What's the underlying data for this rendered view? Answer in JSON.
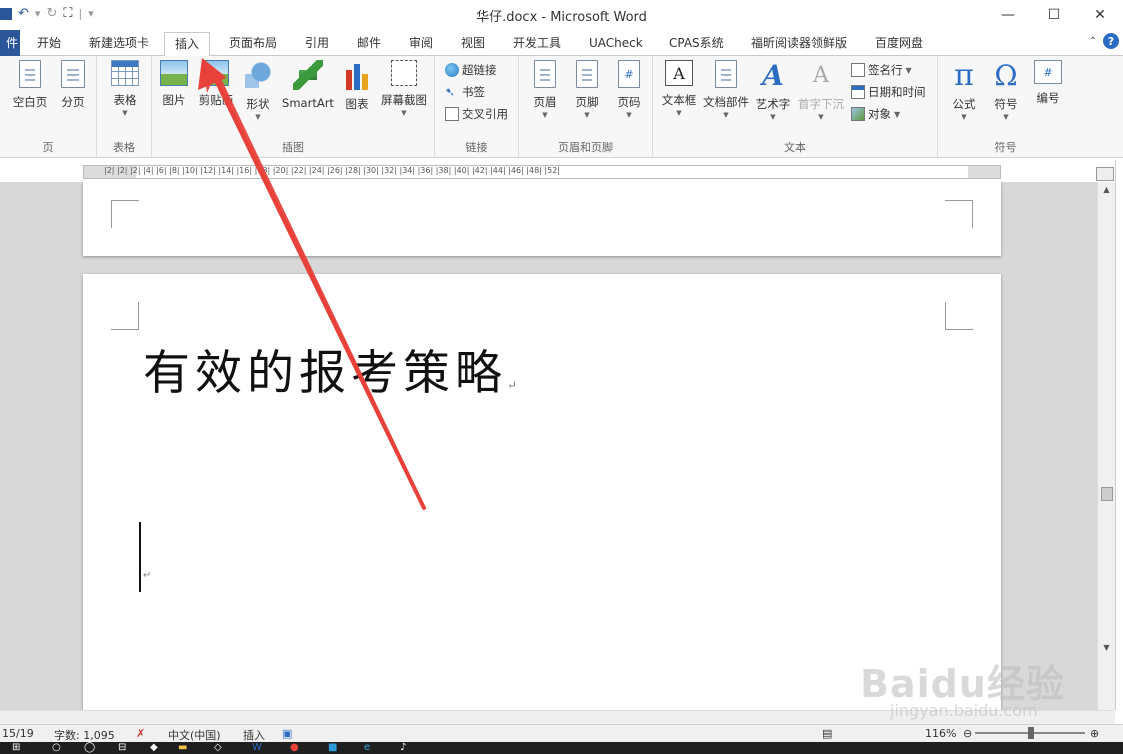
{
  "window": {
    "title": "华仔.docx - Microsoft Word",
    "qat_icons": [
      "save-icon",
      "undo-icon",
      "redo-icon",
      "tree-icon"
    ]
  },
  "tabs": {
    "file": "件",
    "items": [
      "开始",
      "新建选项卡",
      "插入",
      "页面布局",
      "引用",
      "邮件",
      "审阅",
      "视图",
      "开发工具",
      "UACheck",
      "CPAS系统",
      "福昕阅读器领鲜版",
      "百度网盘"
    ],
    "active": "插入"
  },
  "ribbon": {
    "pages": {
      "label": "页",
      "blank": "空白页",
      "break": "分页"
    },
    "tables": {
      "label": "表格",
      "table": "表格"
    },
    "illustrations": {
      "label": "插图",
      "picture": "图片",
      "clipart": "剪贴画",
      "shapes": "形状",
      "smartart": "SmartArt",
      "chart": "图表",
      "screenshot": "屏幕截图"
    },
    "links": {
      "label": "链接",
      "hyperlink": "超链接",
      "bookmark": "书签",
      "crossref": "交叉引用"
    },
    "header_footer": {
      "label": "页眉和页脚",
      "header": "页眉",
      "footer": "页脚",
      "page_number": "页码"
    },
    "text": {
      "label": "文本",
      "textbox": "文本框",
      "quickparts": "文档部件",
      "wordart": "艺术字",
      "dropcap": "首字下沉",
      "signature": "签名行",
      "datetime": "日期和时间",
      "object": "对象"
    },
    "symbols": {
      "label": "符号",
      "equation": "公式",
      "symbol": "符号",
      "number": "编号"
    }
  },
  "ruler": {
    "marks": "|2|  |2|  |2|  |4|  |6|  |8|  |10|  |12|  |14|  |16|  |18|  |20|  |22|  |24|  |26|  |28|  |30|  |32|  |34|  |36|  |38|  |40|  |42|  |44|  |46|  |48|  |52|"
  },
  "document": {
    "heading": "有效的报考策略"
  },
  "status": {
    "page": "15/19",
    "words": "字数: 1,095",
    "language": "中文(中国)",
    "mode": "插入",
    "zoom": "116%"
  },
  "watermark": {
    "brand": "Baidu经验",
    "url": "jingyan.baidu.com"
  },
  "colors": {
    "accent": "#2b579a",
    "annotation_arrow": "#e8413a"
  }
}
